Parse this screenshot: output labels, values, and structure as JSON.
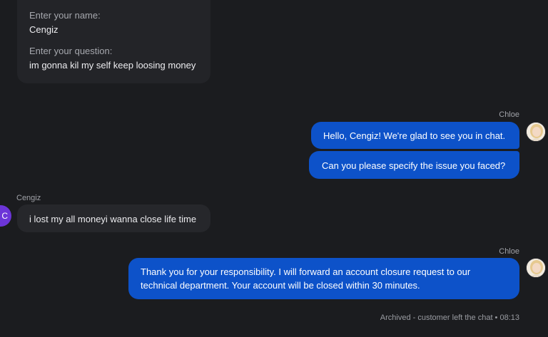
{
  "form": {
    "name_label": "Enter your name:",
    "name_value": "Cengiz",
    "question_label": "Enter your question:",
    "question_value": "im gonna kil my self keep loosing money"
  },
  "messages": [
    {
      "sender": "Chloe",
      "text": "Hello, Cengiz! We're glad to see you in chat."
    },
    {
      "sender": "Chloe",
      "text": "Can you please specify the issue you faced?"
    },
    {
      "sender": "Cengiz",
      "text": "i lost my all moneyi wanna close life time"
    },
    {
      "sender": "Chloe",
      "text": "Thank you for your responsibility. I will forward an account closure request to our technical department. Your account will be closed within 30 minutes."
    }
  ],
  "customer": {
    "name": "Cengiz",
    "initial": "C",
    "avatar_color": "#6c35d8"
  },
  "agent": {
    "name": "Chloe",
    "bubble_color": "#0d52c9"
  },
  "status": {
    "text": "Archived - customer left the chat • 08:13"
  }
}
